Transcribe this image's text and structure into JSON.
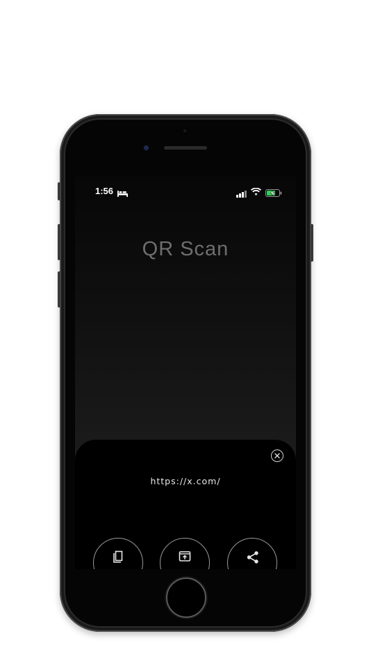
{
  "status_bar": {
    "time": "1:56",
    "icons": [
      "bed-icon",
      "signal-icon",
      "wifi-icon",
      "battery-charging-icon"
    ]
  },
  "app": {
    "title": "QR Scan"
  },
  "result": {
    "url": "https://x.com/",
    "close_icon": "close-icon",
    "actions": [
      {
        "icon": "copy-icon"
      },
      {
        "icon": "open-in-browser-icon"
      },
      {
        "icon": "share-icon"
      }
    ]
  },
  "colors": {
    "screen_background": "#0b0b0b",
    "sheet_background": "#000000",
    "title_text": "#6e6e6e",
    "battery_charging": "#31d158"
  }
}
